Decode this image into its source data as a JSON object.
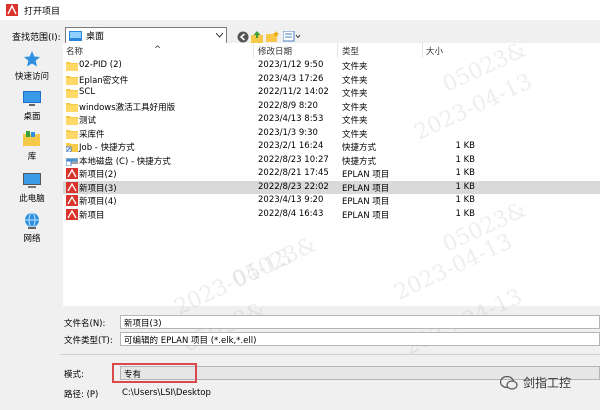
{
  "window": {
    "title": "打开项目"
  },
  "lookin": {
    "label": "查找范围(I):",
    "value": "桌面"
  },
  "places": [
    {
      "label": "快速访问",
      "icon": "star-icon"
    },
    {
      "label": "桌面",
      "icon": "desktop-icon"
    },
    {
      "label": "库",
      "icon": "library-icon"
    },
    {
      "label": "此电脑",
      "icon": "computer-icon"
    },
    {
      "label": "网络",
      "icon": "network-icon"
    }
  ],
  "columns": {
    "name": "名称",
    "date": "修改日期",
    "type": "类型",
    "size": "大小"
  },
  "files": [
    {
      "name": "02-PID (2)",
      "date": "2023/1/12 9:50",
      "type": "文件夹",
      "size": "",
      "icon": "folder-icon"
    },
    {
      "name": "Eplan密文件",
      "date": "2023/4/3 17:26",
      "type": "文件夹",
      "size": "",
      "icon": "folder-icon"
    },
    {
      "name": "SCL",
      "date": "2022/11/2 14:02",
      "type": "文件夹",
      "size": "",
      "icon": "folder-icon"
    },
    {
      "name": "windows激活工具好用版",
      "date": "2022/8/9 8:20",
      "type": "文件夹",
      "size": "",
      "icon": "folder-icon"
    },
    {
      "name": "测试",
      "date": "2023/4/13 8:53",
      "type": "文件夹",
      "size": "",
      "icon": "folder-icon"
    },
    {
      "name": "采库件",
      "date": "2023/1/3 9:30",
      "type": "文件夹",
      "size": "",
      "icon": "folder-icon"
    },
    {
      "name": "Job - 快捷方式",
      "date": "2023/2/1 16:24",
      "type": "快捷方式",
      "size": "1 KB",
      "icon": "shortcut-icon"
    },
    {
      "name": "本地磁盘 (C) - 快捷方式",
      "date": "2022/8/23 10:27",
      "type": "快捷方式",
      "size": "1 KB",
      "icon": "drive-shortcut-icon"
    },
    {
      "name": "新项目(2)",
      "date": "2022/8/21 17:45",
      "type": "EPLAN 项目",
      "size": "1 KB",
      "icon": "eplan-icon"
    },
    {
      "name": "新项目(3)",
      "date": "2022/8/23 22:02",
      "type": "EPLAN 项目",
      "size": "1 KB",
      "icon": "eplan-icon",
      "selected": true
    },
    {
      "name": "新项目(4)",
      "date": "2023/4/13 9:20",
      "type": "EPLAN 项目",
      "size": "1 KB",
      "icon": "eplan-icon"
    },
    {
      "name": "新项目",
      "date": "2022/8/4 16:43",
      "type": "EPLAN 项目",
      "size": "1 KB",
      "icon": "eplan-icon"
    }
  ],
  "fields": {
    "filename_label": "文件名(N):",
    "filename_value": "新项目(3)",
    "filetype_label": "文件类型(T):",
    "filetype_value": "可编辑的 EPLAN 项目 (*.elk,*.ell)",
    "mode_label": "模式:",
    "mode_value": "专有",
    "path_label": "路径:",
    "path_hotkey": "(P)",
    "path_value": "C:\\Users\\LSI\\Desktop"
  },
  "brand": {
    "name": "剑指工控"
  },
  "watermark": {
    "lines": [
      "05023&",
      "2023-04-13",
      "05023&",
      "2023-04-13",
      "2023-04-13",
      "05023&",
      "2023-04-13",
      "05023&"
    ]
  },
  "colors": {
    "selection": "#d9d9d9",
    "highlight_box": "#d94b4b",
    "folder": "#f7c948",
    "eplan": "#d9342b"
  }
}
